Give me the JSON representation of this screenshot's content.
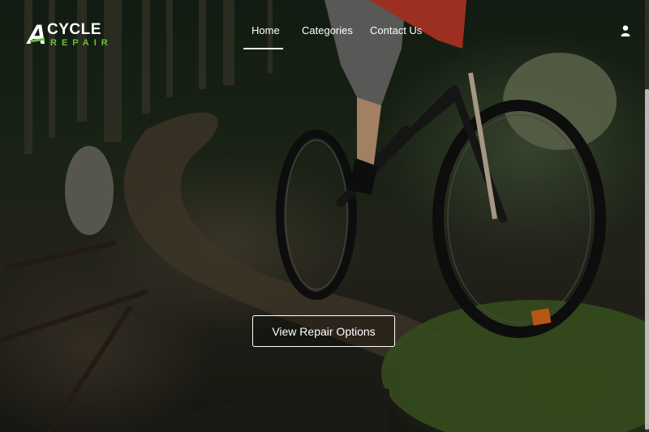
{
  "logo": {
    "letter": "A",
    "title": "CYCLE",
    "subtitle": "REPAIR",
    "accent_color": "#67c23a"
  },
  "nav": {
    "items": [
      {
        "label": "Home",
        "active": true
      },
      {
        "label": "Categories",
        "active": false
      },
      {
        "label": "Contact Us",
        "active": false
      }
    ]
  },
  "header": {
    "user_icon": "user-icon"
  },
  "hero": {
    "image_description_icon": "mountain-bike-photo",
    "cta_label": "View Repair Options"
  }
}
